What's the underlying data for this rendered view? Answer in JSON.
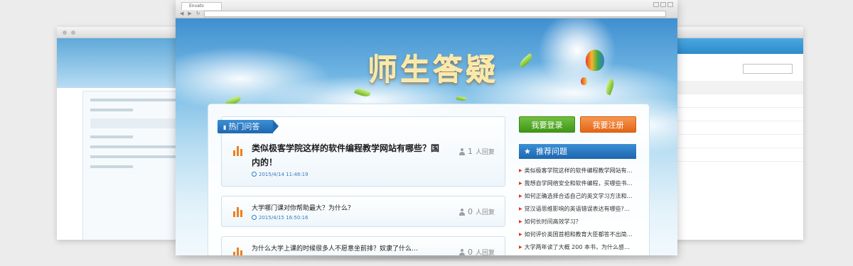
{
  "browser": {
    "tab_label": "Envato"
  },
  "hero": {
    "title": "师生答疑"
  },
  "hot": {
    "label": "热门问答",
    "questions": [
      {
        "title": "类似极客学院这样的软件编程教学网站有哪些？国内的！",
        "time": "2015/4/14 11:48:19",
        "reply_count": "1",
        "reply_label": "人回复"
      },
      {
        "title": "大学哪门课对你帮助最大？为什么？",
        "time": "2015/4/15 16:50:16",
        "reply_count": "0",
        "reply_label": "人回复"
      },
      {
        "title": "为什么大学上课的时候很多人不愿意坐前排？奴隶了什么…",
        "time": "",
        "reply_count": "0",
        "reply_label": "人回复"
      }
    ]
  },
  "actions": {
    "login": "我要登录",
    "register": "我要注册"
  },
  "recommend": {
    "label": "推荐问题",
    "items": [
      "类似极客学院这样的软件编程教学网站有…",
      "我想自学网络安全和软件编程，买哪些书…",
      "如何正确选择合适自己的英文学习方法和…",
      "觉汉语思维影响的英语错误表达有哪些?…",
      "如何长时间高效学习？",
      "如何评价英国首相和教育大臣都答不出简…",
      "大学两年读了大概 200 本书，为什么感…",
      "…"
    ]
  },
  "colors": {
    "accent_blue": "#1f68b0",
    "login_green": "#3f9618",
    "register_orange": "#e36615",
    "bar_orange": "#f07f1e"
  },
  "icons": {
    "hot": "chart-icon",
    "recommend": "star-icon",
    "reply": "person-icon",
    "time": "clock-icon",
    "question": "bar-chart-icon"
  }
}
